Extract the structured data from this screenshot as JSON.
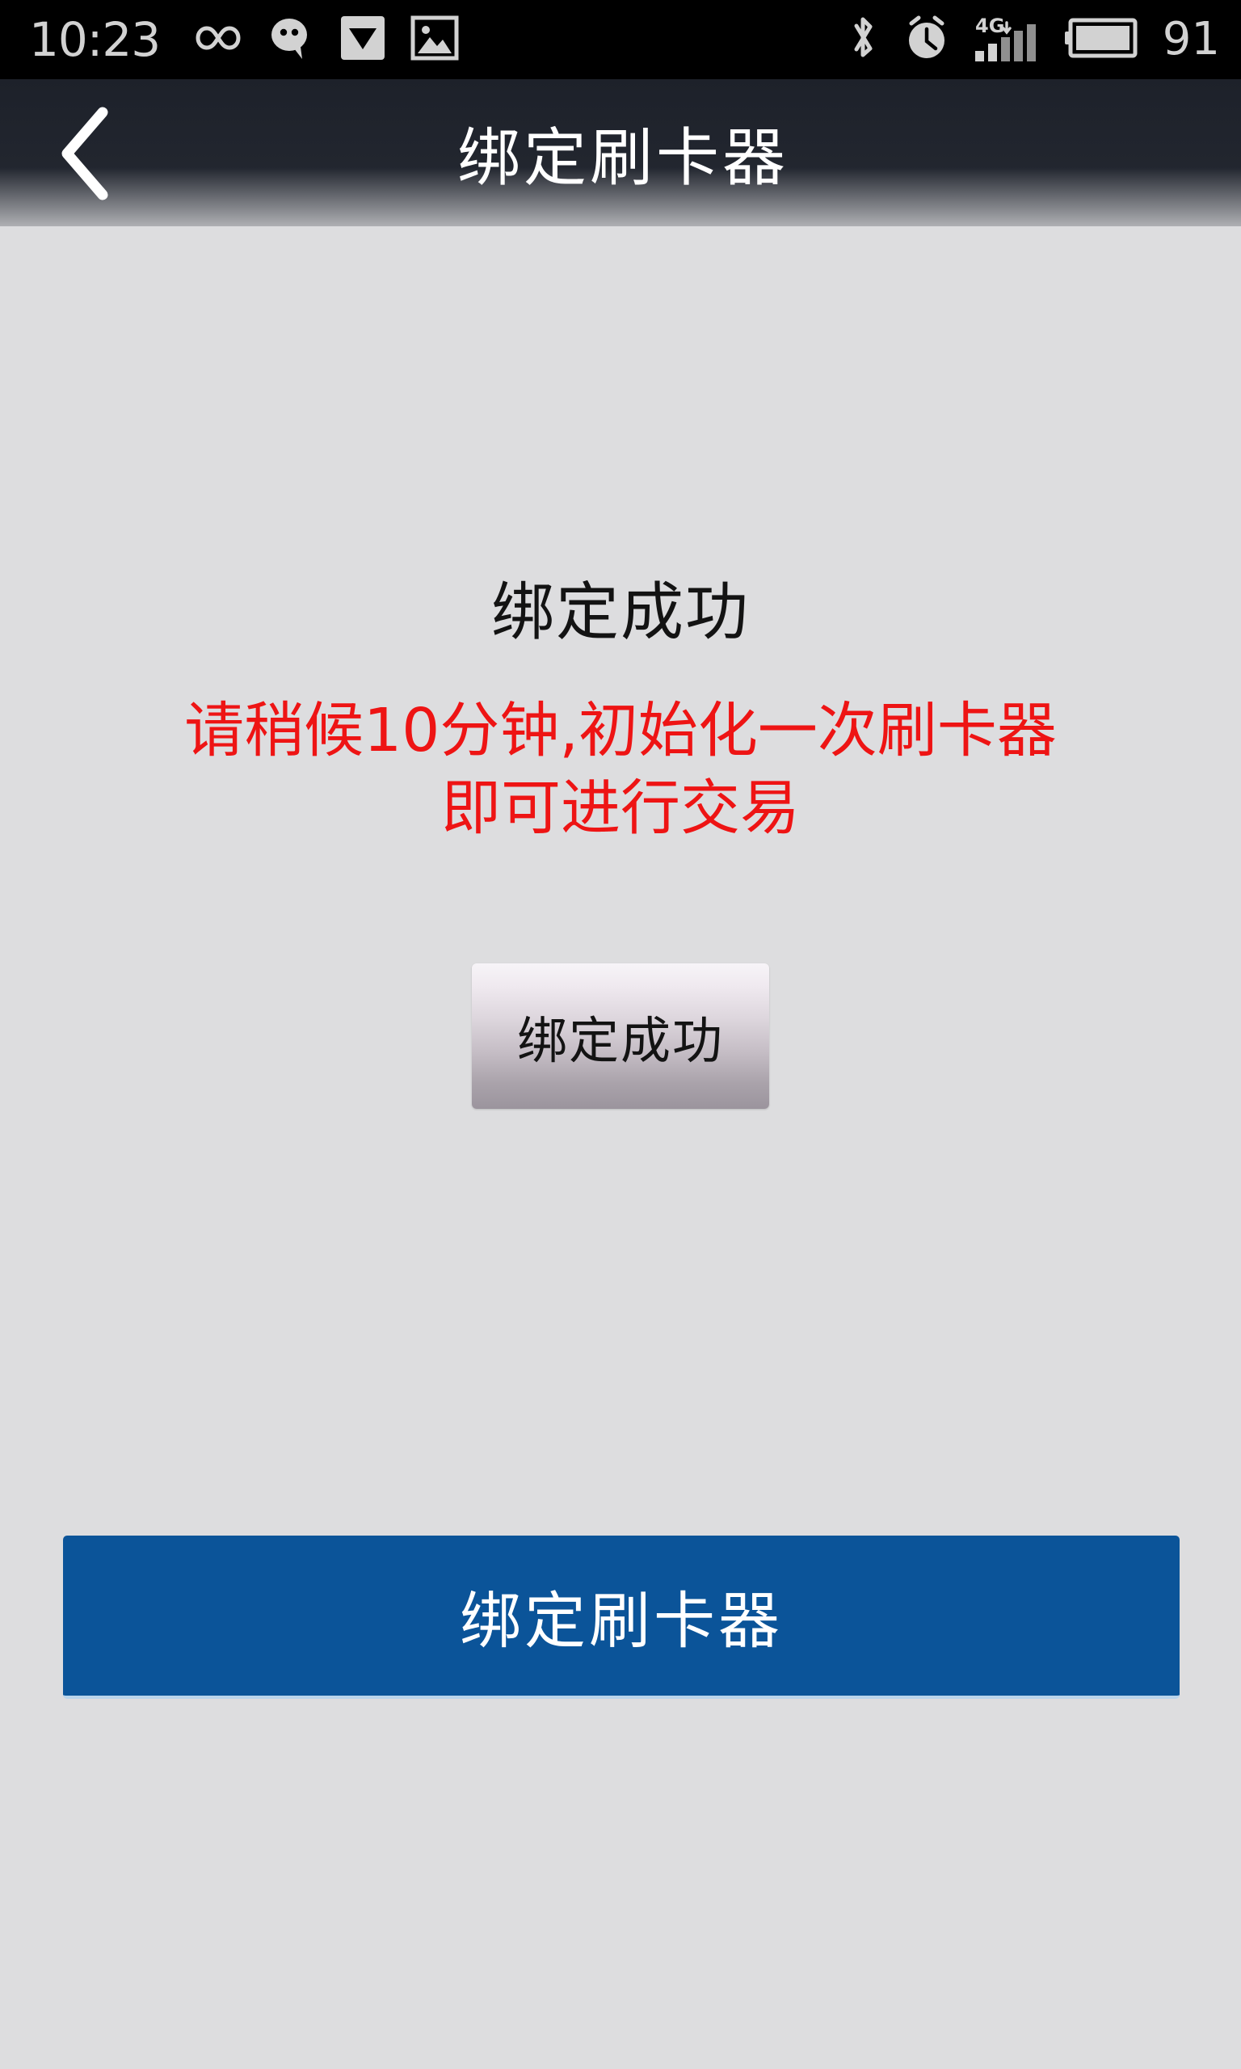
{
  "status_bar": {
    "time": "10:23",
    "battery_percent": "91",
    "left_icons": [
      {
        "name": "infinity-icon",
        "label": "∞"
      },
      {
        "name": "wechat-message-icon",
        "label": "chat bubble"
      },
      {
        "name": "mail-envelope-icon",
        "label": "mail"
      },
      {
        "name": "gallery-image-icon",
        "label": "image"
      }
    ],
    "right_icons": [
      {
        "name": "bluetooth-icon",
        "label": "bluetooth"
      },
      {
        "name": "alarm-clock-icon",
        "label": "alarm"
      },
      {
        "name": "signal-4g-icon",
        "label": "4G"
      },
      {
        "name": "battery-icon",
        "label": "battery"
      }
    ],
    "network_label": "4G"
  },
  "header": {
    "title": "绑定刷卡器",
    "back_icon": "chevron-left-icon"
  },
  "main": {
    "heading": "绑定成功",
    "notice_lines": [
      "请稍候10分钟,初始化一次刷卡器",
      "即可进行交易"
    ],
    "status_button_label": "绑定成功",
    "primary_button_label": "绑定刷卡器"
  },
  "colors": {
    "status_bar_bg": "#000000",
    "header_bg": "#20242e",
    "page_bg": "#dddddf",
    "notice_red": "#ee1414",
    "primary_blue": "#0b5499",
    "heading_black": "#131313",
    "status_icon_gray": "#d2d2d2"
  }
}
